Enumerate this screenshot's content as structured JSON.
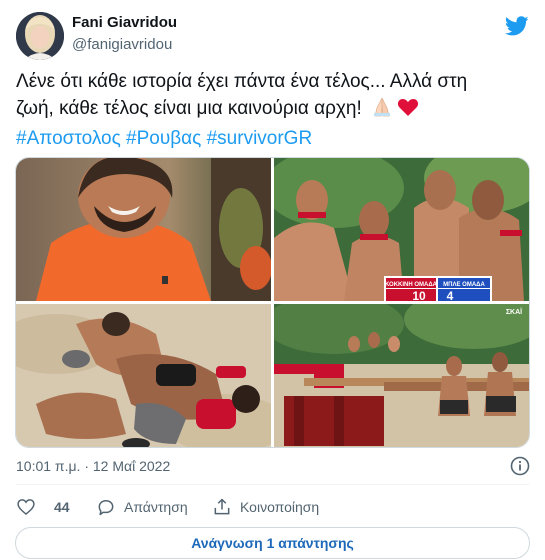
{
  "author": {
    "display_name": "Fani Giavridou",
    "handle": "@fanigiavridou",
    "avatar_icon": "profile-photo"
  },
  "tweet": {
    "text_line1": "Λένε ότι κάθε ιστορία έχει πάντα ένα τέλος... Αλλά στη",
    "text_line2": "ζωή, κάθε τέλος είναι μια καινούρια αρχη!",
    "emoji": [
      "folded-hands-icon",
      "red-heart-icon"
    ],
    "hashtags": [
      "#Αποστολος",
      "#Ρουβας",
      "#survivorGR"
    ]
  },
  "media": {
    "images": [
      {
        "name": "smiling-man-orange-shirt-photo"
      },
      {
        "name": "celebrating-men-scoreboard-photo"
      },
      {
        "name": "group-hug-on-sand-photo"
      },
      {
        "name": "obstacle-course-finish-photo"
      }
    ],
    "scoreboard": {
      "team_left": "ΚΟΚΚΙΝΗ ΟΜΑΔΑ",
      "score_left": "10",
      "team_right": "ΜΠΛΕ ΟΜΑΔΑ",
      "score_right": "4",
      "channel": "ΣΚΑΪ"
    }
  },
  "meta": {
    "timestamp": "10:01 π.μ. · 12 Μαΐ 2022"
  },
  "actions": {
    "like_count": "44",
    "reply_label": "Απάντηση",
    "share_label": "Κοινοποίηση",
    "read_replies_label": "Ανάγνωση 1 απάντησης"
  },
  "colors": {
    "accent": "#1d9bf0",
    "text": "#0f1419",
    "muted": "#536471",
    "border": "#cfd9de"
  }
}
